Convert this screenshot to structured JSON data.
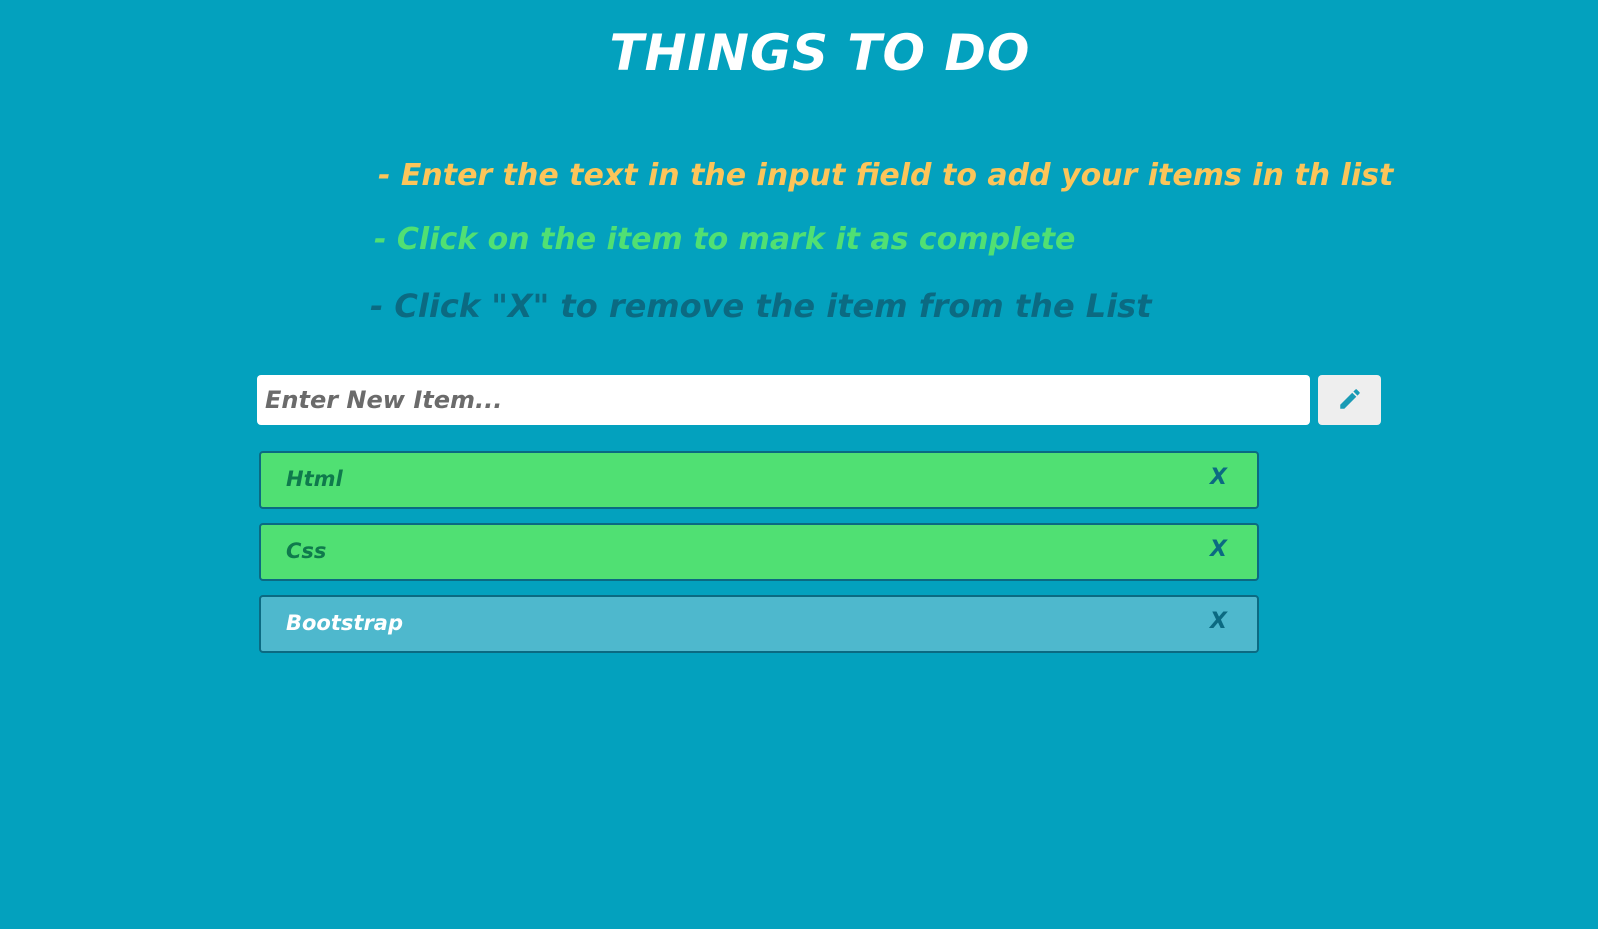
{
  "header": {
    "title": "THINGS TO DO"
  },
  "instructions": [
    {
      "text": "- Enter the text in the input field to add your items in th list",
      "color": "#fcc55a"
    },
    {
      "text": "- Click on the item to mark it as complete",
      "color": "#50e073"
    },
    {
      "text": "- Click \"X\" to remove the item from the List",
      "color": "#0b6a82"
    }
  ],
  "new_item": {
    "value": "",
    "placeholder": "Enter New Item...",
    "button_icon": "pencil-icon"
  },
  "todos": [
    {
      "label": "Html",
      "remove_label": "X",
      "status": "complete"
    },
    {
      "label": "Css",
      "remove_label": "X",
      "status": "complete"
    },
    {
      "label": "Bootstrap",
      "remove_label": "X",
      "status": "pending"
    }
  ],
  "colors": {
    "background": "#03a1be",
    "complete": "#50e073",
    "pending": "#4eb8cd",
    "border": "#0b6a82",
    "accent_yellow": "#fcc55a"
  }
}
